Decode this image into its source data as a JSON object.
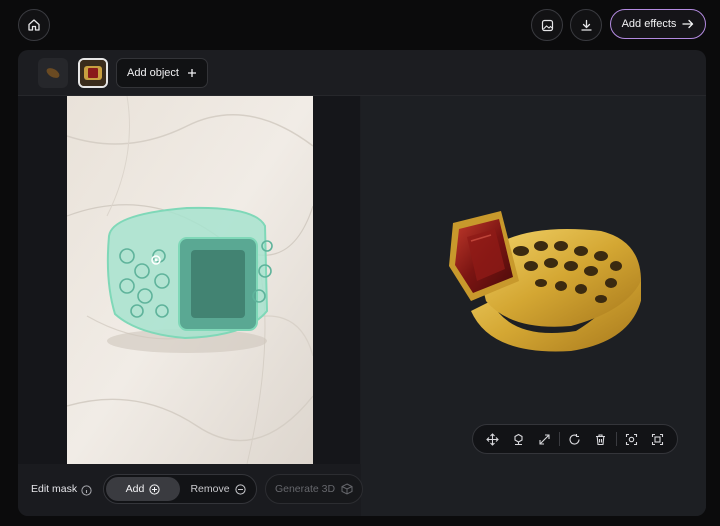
{
  "topbar": {
    "home_icon": "home-icon",
    "image_icon": "image-icon",
    "download_icon": "download-icon",
    "effects_label": "Add effects",
    "accent": "#b38ae0"
  },
  "objects": {
    "add_label": "Add object"
  },
  "mask": {
    "label": "Edit mask",
    "add_label": "Add",
    "remove_label": "Remove",
    "generate_label": "Generate 3D",
    "mask_color": "#7fd8b8"
  },
  "tools": [
    "move-icon",
    "pivot-icon",
    "expand-icon",
    "rotate-reset-icon",
    "trash-icon",
    "focus-icon",
    "frame-icon"
  ]
}
